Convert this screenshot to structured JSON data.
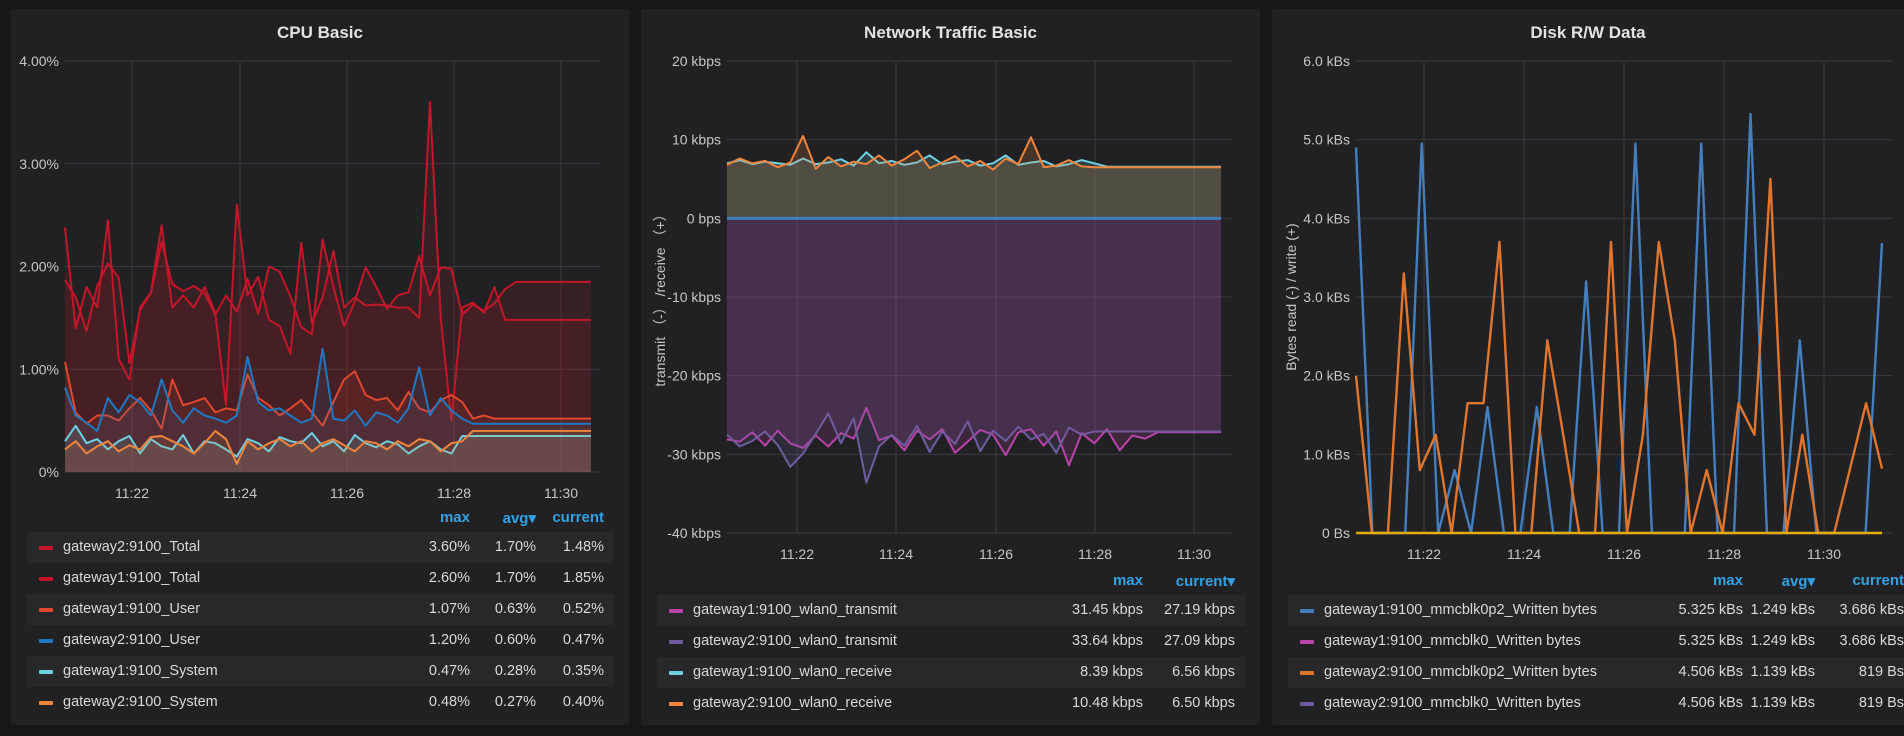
{
  "panels": [
    {
      "title": "CPU Basic",
      "y_ticks": [
        "4.00%",
        "3.00%",
        "2.00%",
        "1.00%",
        "0%"
      ],
      "x_ticks": [
        "11:22",
        "11:24",
        "11:26",
        "11:28",
        "11:30"
      ],
      "y_label": "",
      "y_range": [
        0,
        4
      ],
      "zero_value": 0,
      "legend_headers": [
        "max",
        "avg▾",
        "current"
      ],
      "legend": [
        {
          "name": "gateway2:9100_Total",
          "color": "#c4162a",
          "values": [
            "3.60%",
            "1.70%",
            "1.48%"
          ]
        },
        {
          "name": "gateway1:9100_Total",
          "color": "#c4162a",
          "values": [
            "2.60%",
            "1.70%",
            "1.85%"
          ]
        },
        {
          "name": "gateway1:9100_User",
          "color": "#e0472f",
          "values": [
            "1.07%",
            "0.63%",
            "0.52%"
          ]
        },
        {
          "name": "gateway2:9100_User",
          "color": "#1f78c1",
          "values": [
            "1.20%",
            "0.60%",
            "0.47%"
          ]
        },
        {
          "name": "gateway1:9100_System",
          "color": "#6ed0e0",
          "values": [
            "0.47%",
            "0.28%",
            "0.35%"
          ]
        },
        {
          "name": "gateway2:9100_System",
          "color": "#ef843c",
          "values": [
            "0.48%",
            "0.27%",
            "0.40%"
          ]
        }
      ]
    },
    {
      "title": "Network Traffic Basic",
      "y_ticks": [
        "20 kbps",
        "10 kbps",
        "0 bps",
        "-10 kbps",
        "-20 kbps",
        "-30 kbps",
        "-40 kbps"
      ],
      "x_ticks": [
        "11:22",
        "11:24",
        "11:26",
        "11:28",
        "11:30"
      ],
      "y_label": "transmit （-） /receive （+）",
      "y_range": [
        -40,
        20
      ],
      "zero_value": 0,
      "legend_headers": [
        "max",
        "current▾"
      ],
      "legend": [
        {
          "name": "gateway1:9100_wlan0_transmit",
          "color": "#ba43a9",
          "values": [
            "31.45 kbps",
            "27.19 kbps"
          ]
        },
        {
          "name": "gateway2:9100_wlan0_transmit",
          "color": "#705da0",
          "values": [
            "33.64 kbps",
            "27.09 kbps"
          ]
        },
        {
          "name": "gateway1:9100_wlan0_receive",
          "color": "#6ed0e0",
          "values": [
            "8.39 kbps",
            "6.56 kbps"
          ]
        },
        {
          "name": "gateway2:9100_wlan0_receive",
          "color": "#ef843c",
          "values": [
            "10.48 kbps",
            "6.50 kbps"
          ]
        }
      ]
    },
    {
      "title": "Disk R/W Data",
      "y_ticks": [
        "6.0 kBs",
        "5.0 kBs",
        "4.0 kBs",
        "3.0 kBs",
        "2.0 kBs",
        "1.0 kBs",
        "0 Bs"
      ],
      "x_ticks": [
        "11:22",
        "11:24",
        "11:26",
        "11:28",
        "11:30"
      ],
      "y_label": "Bytes read (-) / write (+)",
      "y_range": [
        0,
        6
      ],
      "zero_value": 0,
      "legend_headers": [
        "max",
        "avg▾",
        "current"
      ],
      "legend": [
        {
          "name": "gateway1:9100_mmcblk0p2_Written bytes",
          "color": "#447ebc",
          "values": [
            "5.325 kBs",
            "1.249 kBs",
            "3.686 kBs"
          ]
        },
        {
          "name": "gateway1:9100_mmcblk0_Written bytes",
          "color": "#ba43a9",
          "values": [
            "5.325 kBs",
            "1.249 kBs",
            "3.686 kBs"
          ]
        },
        {
          "name": "gateway2:9100_mmcblk0p2_Written bytes",
          "color": "#e0752d",
          "values": [
            "4.506 kBs",
            "1.139 kBs",
            "819 Bs"
          ]
        },
        {
          "name": "gateway2:9100_mmcblk0_Written bytes",
          "color": "#705da0",
          "values": [
            "4.506 kBs",
            "1.139 kBs",
            "819 Bs"
          ]
        }
      ]
    }
  ],
  "chart_data": [
    {
      "type": "line",
      "title": "CPU Basic",
      "x": [
        "11:21",
        "11:21",
        "11:21",
        "11:21",
        "11:22",
        "11:22",
        "11:22",
        "11:22",
        "11:22",
        "11:23",
        "11:23",
        "11:23",
        "11:23",
        "11:23",
        "11:24",
        "11:24",
        "11:24",
        "11:24",
        "11:24",
        "11:25",
        "11:25",
        "11:25",
        "11:25",
        "11:25",
        "11:26",
        "11:26",
        "11:26",
        "11:26",
        "11:26",
        "11:27",
        "11:27",
        "11:27",
        "11:27",
        "11:27",
        "11:28",
        "11:28",
        "11:28",
        "11:28",
        "11:28",
        "11:29",
        "11:29",
        "11:29",
        "11:29",
        "11:29",
        "11:30",
        "11:30",
        "11:30",
        "11:30",
        "11:30",
        "11:31"
      ],
      "ylim": [
        0,
        4
      ],
      "series": [
        {
          "name": "gateway2:9100_Total",
          "values": [
            2.38,
            1.4,
            1.8,
            1.6,
            2.45,
            1.1,
            0.9,
            1.6,
            1.75,
            2.4,
            1.6,
            1.72,
            1.6,
            1.8,
            1.55,
            0.65,
            2.6,
            1.72,
            1.9,
            1.48,
            1.42,
            1.15,
            2.23,
            1.45,
            1.7,
            2.15,
            1.6,
            1.7,
            1.62,
            1.63,
            1.62,
            1.6,
            1.6,
            1.5,
            3.6,
            1.5,
            0.5,
            1.6,
            1.65,
            1.55,
            1.8,
            1.48,
            1.48,
            1.48,
            1.48,
            1.48,
            1.48,
            1.48,
            1.48,
            1.48
          ]
        },
        {
          "name": "gateway1:9100_Total",
          "values": [
            1.87,
            1.7,
            1.37,
            1.81,
            2.03,
            1.89,
            1.06,
            1.58,
            1.74,
            2.24,
            1.83,
            1.76,
            1.81,
            1.74,
            1.53,
            1.72,
            1.56,
            1.88,
            1.54,
            2.0,
            1.95,
            1.71,
            1.41,
            1.34,
            2.26,
            1.8,
            1.42,
            1.66,
            1.99,
            1.8,
            1.59,
            1.72,
            1.75,
            2.1,
            1.72,
            1.99,
            1.98,
            1.53,
            1.63,
            1.57,
            1.64,
            1.78,
            1.85,
            1.85,
            1.85,
            1.85,
            1.85,
            1.85,
            1.85,
            1.85
          ]
        },
        {
          "name": "gateway1:9100_User",
          "values": [
            1.07,
            0.58,
            0.47,
            0.55,
            0.55,
            0.5,
            0.62,
            0.72,
            0.6,
            0.42,
            0.9,
            0.65,
            0.68,
            0.72,
            0.58,
            0.62,
            0.6,
            0.95,
            0.72,
            0.65,
            0.55,
            0.62,
            0.7,
            0.58,
            0.45,
            0.68,
            0.9,
            0.98,
            0.75,
            0.7,
            0.72,
            0.6,
            0.78,
            0.62,
            0.58,
            0.7,
            0.75,
            0.68,
            0.52,
            0.55,
            0.52,
            0.52,
            0.52,
            0.52,
            0.52,
            0.52,
            0.52,
            0.52,
            0.52,
            0.52
          ]
        },
        {
          "name": "gateway2:9100_User",
          "values": [
            0.82,
            0.55,
            0.48,
            0.4,
            0.72,
            0.58,
            0.75,
            0.68,
            0.55,
            0.9,
            0.6,
            0.48,
            0.62,
            0.55,
            0.52,
            0.48,
            0.55,
            1.12,
            0.68,
            0.6,
            0.62,
            0.55,
            0.48,
            0.52,
            1.2,
            0.52,
            0.5,
            0.6,
            0.45,
            0.58,
            0.55,
            0.48,
            0.62,
            1.02,
            0.55,
            0.72,
            0.6,
            0.52,
            0.47,
            0.47,
            0.47,
            0.47,
            0.47,
            0.47,
            0.47,
            0.47,
            0.47,
            0.47,
            0.47,
            0.47
          ]
        },
        {
          "name": "gateway1:9100_System",
          "values": [
            0.3,
            0.45,
            0.28,
            0.32,
            0.22,
            0.3,
            0.35,
            0.18,
            0.32,
            0.25,
            0.22,
            0.36,
            0.18,
            0.3,
            0.28,
            0.22,
            0.15,
            0.32,
            0.28,
            0.2,
            0.34,
            0.3,
            0.28,
            0.38,
            0.25,
            0.3,
            0.2,
            0.36,
            0.28,
            0.24,
            0.3,
            0.27,
            0.18,
            0.25,
            0.3,
            0.22,
            0.18,
            0.35,
            0.35,
            0.35,
            0.35,
            0.35,
            0.35,
            0.35,
            0.35,
            0.35,
            0.35,
            0.35,
            0.35,
            0.35
          ]
        },
        {
          "name": "gateway2:9100_System",
          "values": [
            0.22,
            0.3,
            0.18,
            0.25,
            0.3,
            0.2,
            0.26,
            0.22,
            0.34,
            0.35,
            0.3,
            0.25,
            0.18,
            0.28,
            0.4,
            0.32,
            0.08,
            0.3,
            0.22,
            0.28,
            0.32,
            0.25,
            0.3,
            0.2,
            0.28,
            0.32,
            0.26,
            0.2,
            0.3,
            0.28,
            0.22,
            0.3,
            0.25,
            0.32,
            0.3,
            0.2,
            0.28,
            0.3,
            0.4,
            0.4,
            0.4,
            0.4,
            0.4,
            0.4,
            0.4,
            0.4,
            0.4,
            0.4,
            0.4,
            0.4
          ]
        }
      ]
    },
    {
      "type": "area",
      "title": "Network Traffic Basic",
      "ylabel": "transmit （-） /receive （+）",
      "ylim": [
        -40,
        20
      ],
      "x_ticks": [
        "11:22",
        "11:24",
        "11:26",
        "11:28",
        "11:30"
      ],
      "series": [
        {
          "name": "gateway1:9100_wlan0_transmit",
          "values": [
            -28.1,
            -28.4,
            -27.2,
            -28.9,
            -27.0,
            -28.6,
            -29.2,
            -27.6,
            -29.0,
            -27.3,
            -28.0,
            -24.1,
            -28.2,
            -27.6,
            -29.5,
            -27.0,
            -28.1,
            -26.8,
            -29.8,
            -28.4,
            -26.9,
            -27.5,
            -30.1,
            -27.2,
            -26.8,
            -28.9,
            -27.1,
            -31.4,
            -27.3,
            -28.6,
            -26.8,
            -29.5,
            -27.6,
            -28.0,
            -27.2,
            -27.2,
            -27.2,
            -27.2,
            -27.2,
            -27.2
          ]
        },
        {
          "name": "gateway2:9100_wlan0_transmit",
          "values": [
            -27.5,
            -29.0,
            -28.3,
            -27.1,
            -28.8,
            -31.6,
            -29.9,
            -27.4,
            -24.8,
            -28.6,
            -25.4,
            -33.6,
            -29.0,
            -27.5,
            -28.9,
            -26.4,
            -29.7,
            -27.1,
            -28.7,
            -25.8,
            -29.6,
            -27.0,
            -28.3,
            -26.5,
            -28.1,
            -27.4,
            -29.8,
            -26.6,
            -27.5,
            -27.1,
            -27.1,
            -27.1,
            -27.1,
            -27.1,
            -27.1,
            -27.1,
            -27.1,
            -27.1,
            -27.1,
            -27.1
          ]
        },
        {
          "name": "gateway1:9100_wlan0_receive",
          "values": [
            7.0,
            7.4,
            6.9,
            7.2,
            7.0,
            6.8,
            7.6,
            6.9,
            7.1,
            7.5,
            6.7,
            8.39,
            7.0,
            7.3,
            6.8,
            7.1,
            8.0,
            6.9,
            7.2,
            7.4,
            6.7,
            7.0,
            8.0,
            6.8,
            7.1,
            7.3,
            6.6,
            6.9,
            7.4,
            7.0,
            6.56,
            6.56,
            6.56,
            6.56,
            6.56,
            6.56,
            6.56,
            6.56,
            6.56,
            6.56
          ]
        },
        {
          "name": "gateway2:9100_wlan0_receive",
          "values": [
            6.8,
            7.6,
            7.0,
            7.3,
            6.5,
            7.1,
            10.48,
            6.3,
            7.8,
            6.6,
            7.2,
            6.9,
            8.0,
            6.7,
            7.5,
            8.6,
            6.4,
            7.1,
            7.9,
            6.6,
            7.3,
            6.2,
            7.6,
            6.9,
            10.3,
            6.5,
            6.7,
            7.4,
            6.6,
            6.5,
            6.5,
            6.5,
            6.5,
            6.5,
            6.5,
            6.5,
            6.5,
            6.5,
            6.5,
            6.5
          ]
        }
      ]
    },
    {
      "type": "line",
      "title": "Disk R/W Data",
      "ylabel": "Bytes read (-) / write (+)",
      "ylim": [
        0,
        6
      ],
      "x_ticks": [
        "11:22",
        "11:24",
        "11:26",
        "11:28",
        "11:30"
      ],
      "series": [
        {
          "name": "gateway1:9100_mmcblk0p2_Written bytes",
          "values": [
            4.9,
            0,
            0,
            0,
            4.95,
            0,
            0.8,
            0,
            1.6,
            0,
            0,
            1.6,
            0,
            0,
            3.2,
            0,
            0,
            4.95,
            0,
            0,
            0,
            4.95,
            0,
            0,
            5.325,
            0,
            0,
            2.45,
            0,
            0,
            0,
            0,
            3.686
          ]
        },
        {
          "name": "gateway1:9100_mmcblk0_Written bytes",
          "values": [
            0,
            0,
            0,
            0,
            0,
            0,
            0,
            0,
            0,
            0,
            0,
            0,
            0,
            0,
            0,
            0,
            0,
            0,
            0,
            0,
            0,
            0,
            0,
            0,
            0,
            0,
            0,
            0,
            0,
            0,
            0,
            0,
            0
          ]
        },
        {
          "name": "gateway2:9100_mmcblk0p2_Written bytes",
          "values": [
            2.0,
            0,
            0,
            3.3,
            0.8,
            1.25,
            0,
            1.65,
            1.65,
            3.7,
            0,
            0,
            2.45,
            1.25,
            0,
            0,
            3.7,
            0,
            1.25,
            3.7,
            2.45,
            0,
            0.8,
            0,
            1.65,
            1.25,
            4.5,
            0,
            1.25,
            0,
            0,
            0.82,
            1.65,
            0.819
          ]
        },
        {
          "name": "gateway2:9100_mmcblk0_Written bytes",
          "values": [
            0,
            0,
            0,
            0,
            0,
            0,
            0,
            0,
            0,
            0,
            0,
            0,
            0,
            0,
            0,
            0,
            0,
            0,
            0,
            0,
            0,
            0,
            0,
            0,
            0,
            0,
            0,
            0,
            0,
            0,
            0,
            0,
            0
          ]
        }
      ]
    }
  ]
}
